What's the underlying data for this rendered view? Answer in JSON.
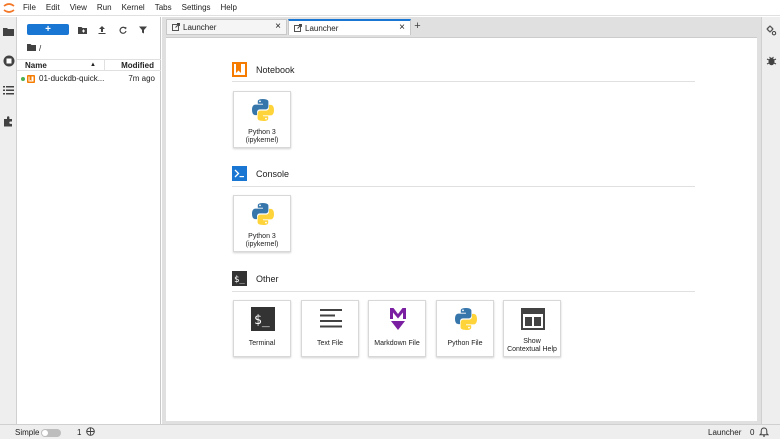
{
  "menu": [
    "File",
    "Edit",
    "View",
    "Run",
    "Kernel",
    "Tabs",
    "Settings",
    "Help"
  ],
  "filebrowser": {
    "new_label": "+",
    "path": "/",
    "col_name": "Name",
    "col_modified": "Modified",
    "files": [
      {
        "name": "01-duckdb-quick...",
        "modified": "7m ago",
        "running": true
      }
    ]
  },
  "tabs": [
    {
      "label": "Launcher",
      "active": false
    },
    {
      "label": "Launcher",
      "active": true
    }
  ],
  "tab_close": "×",
  "add_tab": "+",
  "launcher": {
    "notebook_title": "Notebook",
    "console_title": "Console",
    "other_title": "Other",
    "notebook_cards": [
      {
        "label_line1": "Python 3",
        "label_line2": "(ipykernel)",
        "icon": "python-icon"
      }
    ],
    "console_cards": [
      {
        "label_line1": "Python 3",
        "label_line2": "(ipykernel)",
        "icon": "python-icon"
      }
    ],
    "other_cards": [
      {
        "label": "Terminal",
        "icon": "terminal-icon"
      },
      {
        "label": "Text File",
        "icon": "text-file-icon"
      },
      {
        "label": "Markdown File",
        "icon": "markdown-icon"
      },
      {
        "label": "Python File",
        "icon": "python-icon"
      },
      {
        "label_line1": "Show",
        "label_line2": "Contextual Help",
        "icon": "contextual-help-icon"
      }
    ]
  },
  "statusbar": {
    "simple_label": "Simple",
    "kernel_count": "1",
    "mode": "Launcher",
    "notifications": "0"
  },
  "colors": {
    "accent": "#1976d2",
    "notebook_orange": "#f57c00",
    "markdown_purple": "#7b1fa2",
    "python_blue": "#3776ab",
    "python_yellow": "#ffd43b"
  }
}
